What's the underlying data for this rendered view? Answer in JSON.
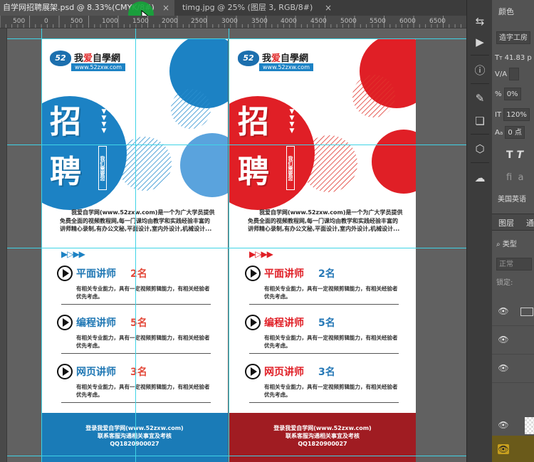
{
  "tabs": [
    {
      "label": "自学网招聘展架.psd @ 8.33%(CMYK/8#)",
      "close": "×"
    },
    {
      "label": "timg.jpg @ 25% (图层 3, RGB/8#)",
      "close": "×"
    }
  ],
  "ruler_labels": [
    "500",
    "0",
    "500",
    "1000",
    "1500",
    "2000",
    "2500",
    "3000",
    "3500",
    "4000",
    "4500",
    "5000",
    "5500",
    "6000",
    "6500"
  ],
  "colors": {
    "blue": "#1c82c4",
    "blue_light": "#5aa3dd",
    "blue_footer": "#1a7bb7",
    "red": "#e01f26",
    "red_footer": "#a01c22",
    "title_blue": "#1f77b4",
    "count_red": "#e34b3c",
    "count_blue": "#2779b7",
    "guide": "#3fd3e6"
  },
  "poster": {
    "logo_name_pre": "我",
    "logo_heart": "爱",
    "logo_name_post": "自學網",
    "logo_badge": "52",
    "logo_url": "www.52zxw.com",
    "big_char_1": "招",
    "big_char_2": "聘",
    "vertical_tag": "我们需要您",
    "chevrons": "▼\n▼\n▼\n▼",
    "intro": "我爱自学网(www.52zxw.com)是一个为广大学员提供免费全面的视频教程网,每一门课均由教学和实践经验丰富的讲师精心录制,有办公文秘,平面设计,室内外设计,机械设计...",
    "arrows_left": "▶▷▶▶",
    "arrows_right": "▶▷▶▶",
    "jobs": [
      {
        "title": "平面讲师",
        "count": "2名",
        "desc": "有相关专业能力，具有一定视频剪辑能力，有相关经验者优先考虑。"
      },
      {
        "title": "编程讲师",
        "count": "5名",
        "desc": "有相关专业能力，具有一定视频剪辑能力，有相关经验者优先考虑。"
      },
      {
        "title": "网页讲师",
        "count": "3名",
        "desc": "有相关专业能力，具有一定视频剪辑能力，有相关经验者优先考虑。"
      }
    ],
    "footer_lines": [
      "登录我爱自学网(www.52zxw.com)",
      "联系客服沟通相关事宜及考核",
      "QQ1820900027"
    ]
  },
  "tools": [
    "swap-icon",
    "play-icon",
    "info-icon",
    "brush-icon",
    "clone-icon",
    "cube-icon",
    "cloud-icon"
  ],
  "properties": {
    "tab": "颜色",
    "font_name": "造字工房",
    "font_size": "41.83 p",
    "tracking_label": "V/A",
    "scale_v": "0%",
    "scale_h": "120%",
    "baseline": "0 点",
    "language": "美国英语"
  },
  "layers": {
    "tab": "图层",
    "tab2": "通",
    "filter": "类型",
    "blend": "正常",
    "lock": "锁定:"
  }
}
